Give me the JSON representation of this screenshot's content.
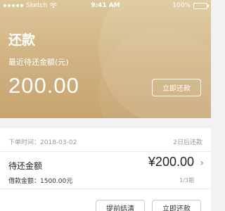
{
  "status_bar": {
    "carrier": "Sketch",
    "time": "9:41 AM",
    "battery": "100%",
    "signal_icon": "signal-dots-icon",
    "wifi_icon": "wifi-icon",
    "battery_icon": "battery-icon"
  },
  "header": {
    "title": "还款",
    "subtitle": "最近待还金额(元)",
    "amount": "200.00",
    "repay_button": "立即还款"
  },
  "order": {
    "date_label": "下单时间：2018-03-02",
    "due_in": "2日后还款"
  },
  "bill": {
    "due_label": "待还金额",
    "due_amount": "¥200.00",
    "loan_label": "借款金额：1500.00元",
    "period": "1/3期"
  },
  "actions": {
    "early_payoff": "提前结清",
    "repay_now": "立即还款"
  },
  "colors": {
    "header_gold": "#cfb080",
    "background": "#f2f2f2"
  }
}
